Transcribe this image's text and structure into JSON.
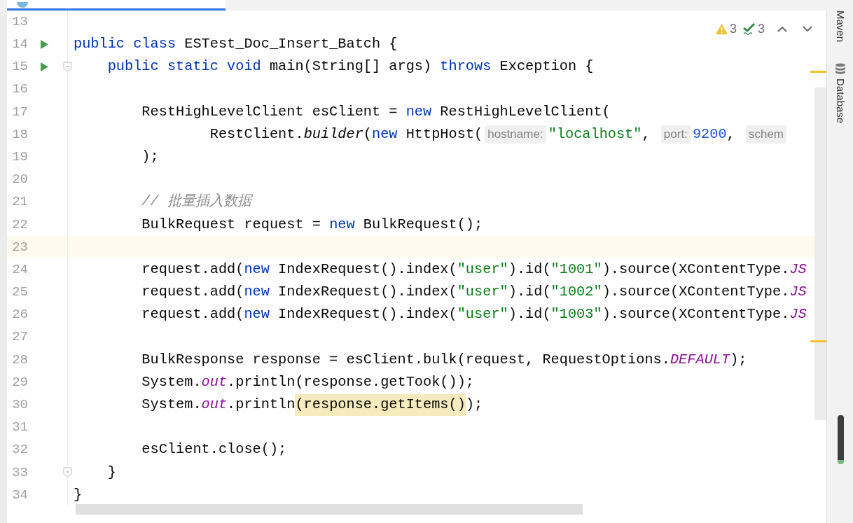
{
  "inspections": {
    "warnings": "3",
    "weak_warnings": "3"
  },
  "tool_windows": [
    {
      "label": "Maven",
      "kind": "plain"
    },
    {
      "label": "Database",
      "kind": "database"
    }
  ],
  "lines": [
    {
      "number": "13",
      "run_icon": false,
      "fold_marker": false,
      "current": false
    },
    {
      "number": "14",
      "run_icon": true,
      "fold_marker": false,
      "current": false,
      "tokens": [
        {
          "kind": "keyword",
          "text": "public class"
        },
        {
          "kind": "plain",
          "text": " ESTest_Doc_Insert_Batch {"
        }
      ]
    },
    {
      "number": "15",
      "run_icon": true,
      "fold_marker": true,
      "current": false,
      "tokens": [
        {
          "kind": "keyword",
          "text": "    public static void"
        },
        {
          "kind": "plain",
          "text": " main(String[] args) "
        },
        {
          "kind": "keyword",
          "text": "throws"
        },
        {
          "kind": "plain",
          "text": " Exception {"
        }
      ]
    },
    {
      "number": "16",
      "run_icon": false,
      "fold_marker": false,
      "current": false
    },
    {
      "number": "17",
      "run_icon": false,
      "fold_marker": false,
      "current": false,
      "tokens": [
        {
          "kind": "plain",
          "text": "        RestHighLevelClient esClient = "
        },
        {
          "kind": "keyword",
          "text": "new"
        },
        {
          "kind": "plain",
          "text": " RestHighLevelClient("
        }
      ]
    },
    {
      "number": "18",
      "run_icon": false,
      "fold_marker": false,
      "current": false,
      "tokens": [
        {
          "kind": "plain",
          "text": "                RestClient."
        },
        {
          "kind": "static_call",
          "text": "builder"
        },
        {
          "kind": "plain",
          "text": "("
        },
        {
          "kind": "keyword",
          "text": "new"
        },
        {
          "kind": "plain",
          "text": " HttpHost("
        },
        {
          "kind": "hint",
          "text": "hostname:"
        },
        {
          "kind": "string",
          "text": "\"localhost\""
        },
        {
          "kind": "plain",
          "text": ", "
        },
        {
          "kind": "hint",
          "text": "port:"
        },
        {
          "kind": "number",
          "text": "9200"
        },
        {
          "kind": "plain",
          "text": ", "
        },
        {
          "kind": "hint",
          "text": "schem"
        }
      ]
    },
    {
      "number": "19",
      "run_icon": false,
      "fold_marker": false,
      "current": false,
      "tokens": [
        {
          "kind": "plain",
          "text": "        );"
        }
      ]
    },
    {
      "number": "20",
      "run_icon": false,
      "fold_marker": false,
      "current": false
    },
    {
      "number": "21",
      "run_icon": false,
      "fold_marker": false,
      "current": false,
      "tokens": [
        {
          "kind": "comment",
          "text": "        // 批量插入数据"
        }
      ]
    },
    {
      "number": "22",
      "run_icon": false,
      "fold_marker": false,
      "current": false,
      "tokens": [
        {
          "kind": "plain",
          "text": "        BulkRequest request = "
        },
        {
          "kind": "keyword",
          "text": "new"
        },
        {
          "kind": "plain",
          "text": " BulkRequest();"
        }
      ]
    },
    {
      "number": "23",
      "run_icon": false,
      "fold_marker": false,
      "current": true
    },
    {
      "number": "24",
      "run_icon": false,
      "fold_marker": false,
      "current": false,
      "tokens": [
        {
          "kind": "plain",
          "text": "        request.add("
        },
        {
          "kind": "keyword",
          "text": "new"
        },
        {
          "kind": "plain",
          "text": " IndexRequest().index("
        },
        {
          "kind": "string",
          "text": "\"user\""
        },
        {
          "kind": "plain",
          "text": ").id("
        },
        {
          "kind": "string",
          "text": "\"1001\""
        },
        {
          "kind": "plain",
          "text": ").source(XContentType."
        },
        {
          "kind": "field",
          "text": "JS"
        }
      ]
    },
    {
      "number": "25",
      "run_icon": false,
      "fold_marker": false,
      "current": false,
      "tokens": [
        {
          "kind": "plain",
          "text": "        request.add("
        },
        {
          "kind": "keyword",
          "text": "new"
        },
        {
          "kind": "plain",
          "text": " IndexRequest().index("
        },
        {
          "kind": "string",
          "text": "\"user\""
        },
        {
          "kind": "plain",
          "text": ").id("
        },
        {
          "kind": "string",
          "text": "\"1002\""
        },
        {
          "kind": "plain",
          "text": ").source(XContentType."
        },
        {
          "kind": "field",
          "text": "JS"
        }
      ]
    },
    {
      "number": "26",
      "run_icon": false,
      "fold_marker": false,
      "current": false,
      "tokens": [
        {
          "kind": "plain",
          "text": "        request.add("
        },
        {
          "kind": "keyword",
          "text": "new"
        },
        {
          "kind": "plain",
          "text": " IndexRequest().index("
        },
        {
          "kind": "string",
          "text": "\"user\""
        },
        {
          "kind": "plain",
          "text": ").id("
        },
        {
          "kind": "string",
          "text": "\"1003\""
        },
        {
          "kind": "plain",
          "text": ").source(XContentType."
        },
        {
          "kind": "field",
          "text": "JS"
        }
      ]
    },
    {
      "number": "27",
      "run_icon": false,
      "fold_marker": false,
      "current": false
    },
    {
      "number": "28",
      "run_icon": false,
      "fold_marker": false,
      "current": false,
      "tokens": [
        {
          "kind": "plain",
          "text": "        BulkResponse response = esClient.bulk(request, RequestOptions."
        },
        {
          "kind": "field",
          "text": "DEFAULT"
        },
        {
          "kind": "plain",
          "text": ");"
        }
      ]
    },
    {
      "number": "29",
      "run_icon": false,
      "fold_marker": false,
      "current": false,
      "tokens": [
        {
          "kind": "plain",
          "text": "        System."
        },
        {
          "kind": "field",
          "text": "out"
        },
        {
          "kind": "plain",
          "text": ".println(response.getTook());"
        }
      ]
    },
    {
      "number": "30",
      "run_icon": false,
      "fold_marker": false,
      "current": false,
      "tokens": [
        {
          "kind": "plain",
          "text": "        System."
        },
        {
          "kind": "field",
          "text": "out"
        },
        {
          "kind": "plain",
          "text": ".println"
        },
        {
          "kind": "highlighted",
          "text": "(response.getItems()"
        },
        {
          "kind": "plain",
          "text": ");"
        }
      ]
    },
    {
      "number": "31",
      "run_icon": false,
      "fold_marker": false,
      "current": false
    },
    {
      "number": "32",
      "run_icon": false,
      "fold_marker": false,
      "current": false,
      "tokens": [
        {
          "kind": "plain",
          "text": "        esClient.close();"
        }
      ]
    },
    {
      "number": "33",
      "run_icon": false,
      "fold_marker": true,
      "current": false,
      "tokens": [
        {
          "kind": "plain",
          "text": "    }"
        }
      ]
    },
    {
      "number": "34",
      "run_icon": false,
      "fold_marker": false,
      "current": false,
      "tokens": [
        {
          "kind": "plain",
          "text": "}"
        }
      ]
    }
  ]
}
